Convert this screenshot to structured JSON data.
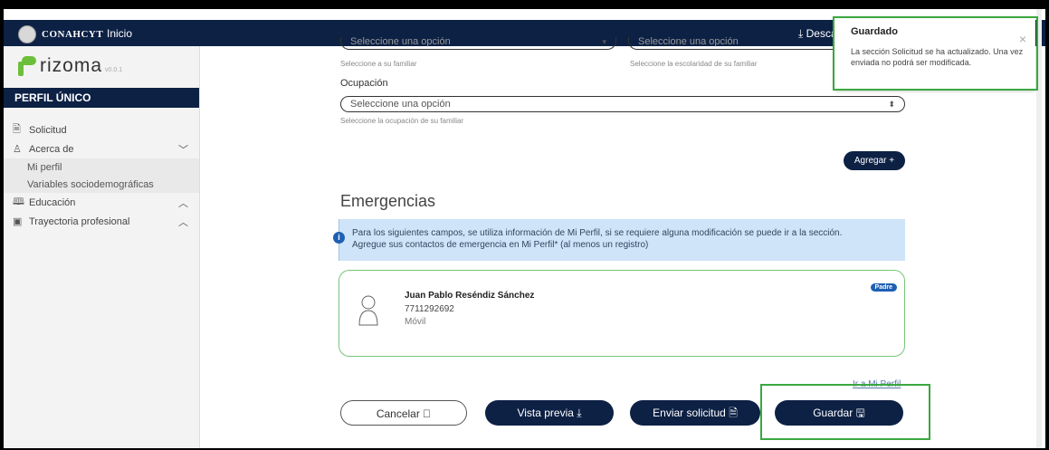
{
  "topbar": {
    "brand": "CONAHCYT",
    "home_label": "Inicio",
    "download_label": "⤓ Descarga"
  },
  "sidebar": {
    "logo_text": "rizoma",
    "logo_version": "v0.0.1",
    "section_title": "PERFIL ÚNICO",
    "items": [
      {
        "label": "Solicitud",
        "icon": "document-icon"
      },
      {
        "label": "Acerca de",
        "icon": "person-icon",
        "chevron": "﹀"
      },
      {
        "label": "Mi perfil"
      },
      {
        "label": "Variables sociodemográficas"
      },
      {
        "label": "Educación",
        "icon": "book-icon",
        "chevron": "︿"
      },
      {
        "label": "Trayectoria profesional",
        "icon": "briefcase-icon",
        "chevron": "︿"
      }
    ]
  },
  "form": {
    "select1_value": "Seleccione una opción",
    "select1_help": "Seleccione a su familiar",
    "select2_value": "Seleccione una opción",
    "select2_help": "Seleccione la escolaridad de su familiar",
    "ocupacion_label": "Ocupación",
    "ocupacion_value": "Seleccione una opción",
    "ocupacion_help": "Seleccione la ocupación de su familiar",
    "agregar_label": "Agregar +"
  },
  "emergencias": {
    "title": "Emergencias",
    "alert_line1": "Para los siguientes campos, se utiliza información de Mi Perfil, si se requiere alguna modificación se puede ir a la sección.",
    "alert_line2": "Agregue sus contactos de emergencia en Mi Perfil* (al menos un registro)",
    "contact": {
      "name": "Juan Pablo Reséndiz Sánchez",
      "phone": "7711292692",
      "phone_type": "Móvil",
      "relation": "Padre"
    },
    "link": "Ir a Mi Perfil"
  },
  "actions": {
    "cancel": "Cancelar ⃠",
    "preview": "Vista previa ⤓",
    "send": "Enviar solicitud 🗎",
    "save": "Guardar 🖫"
  },
  "toast": {
    "title": "Guardado",
    "message": "La sección Solicitud se ha actualizado. Una vez enviada no podrá ser modificada."
  },
  "colors": {
    "navy": "#0d2145",
    "highlight_green": "#3aa83f",
    "card_border": "#77c57a"
  }
}
